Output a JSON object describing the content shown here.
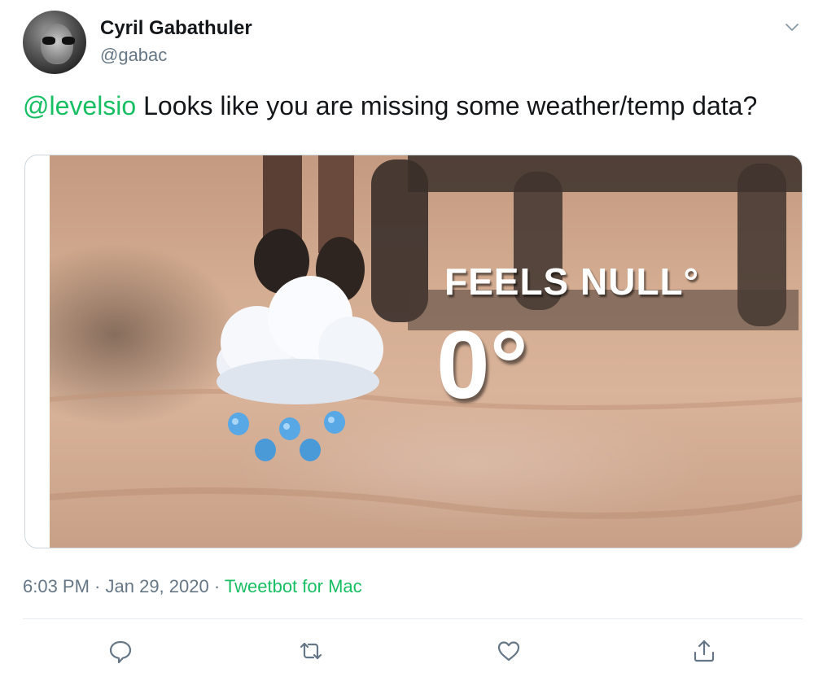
{
  "tweet": {
    "author": {
      "display_name": "Cyril Gabathuler",
      "handle": "@gabac"
    },
    "text": {
      "mention": "@levelsio",
      "body": " Looks like you are missing some weather/temp data?"
    },
    "media": {
      "feels_text": "FEELS NULL°",
      "temperature_text": "0°"
    },
    "meta": {
      "time": "6:03 PM",
      "sep1": " · ",
      "date": "Jan 29, 2020",
      "sep2": " · ",
      "source": "Tweetbot for Mac"
    }
  },
  "colors": {
    "accent": "#17bf63",
    "secondary_text": "#657786",
    "primary_text": "#14171a",
    "border": "#ccd6dd"
  },
  "icons": [
    "chevron-down-icon",
    "reply-icon",
    "retweet-icon",
    "like-icon",
    "share-icon"
  ]
}
